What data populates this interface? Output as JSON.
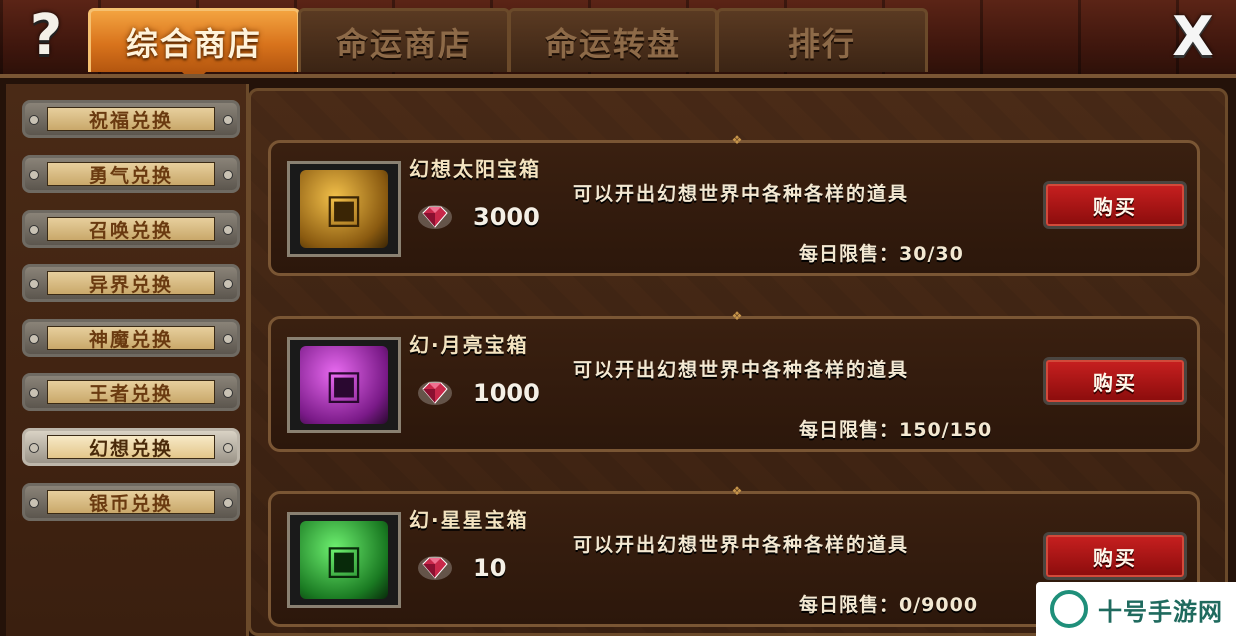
{
  "help_glyph": "?",
  "close_glyph": "X",
  "tabs": [
    {
      "label": "综合商店",
      "active": true
    },
    {
      "label": "命运商店",
      "active": false
    },
    {
      "label": "命运转盘",
      "active": false
    },
    {
      "label": "排行",
      "active": false
    }
  ],
  "sidebar": {
    "items": [
      {
        "label": "祝福兑换",
        "active": false
      },
      {
        "label": "勇气兑换",
        "active": false
      },
      {
        "label": "召唤兑换",
        "active": false
      },
      {
        "label": "异界兑换",
        "active": false
      },
      {
        "label": "神魔兑换",
        "active": false
      },
      {
        "label": "王者兑换",
        "active": false
      },
      {
        "label": "幻想兑换",
        "active": true
      },
      {
        "label": "银币兑换",
        "active": false
      }
    ]
  },
  "items": [
    {
      "name": "幻想太阳宝箱",
      "desc": "可以开出幻想世界中各种各样的道具",
      "price": "3000",
      "limit": "每日限售：30/30",
      "buy_label": "购买",
      "chest_color": "#c98a1e"
    },
    {
      "name": "幻·月亮宝箱",
      "desc": "可以开出幻想世界中各种各样的道具",
      "price": "1000",
      "limit": "每日限售：150/150",
      "buy_label": "购买",
      "chest_color": "#b42bc4"
    },
    {
      "name": "幻·星星宝箱",
      "desc": "可以开出幻想世界中各种各样的道具",
      "price": "10",
      "limit": "每日限售：0/9000",
      "buy_label": "购买",
      "chest_color": "#2fae3a"
    }
  ],
  "watermark": {
    "text": "十号手游网"
  }
}
